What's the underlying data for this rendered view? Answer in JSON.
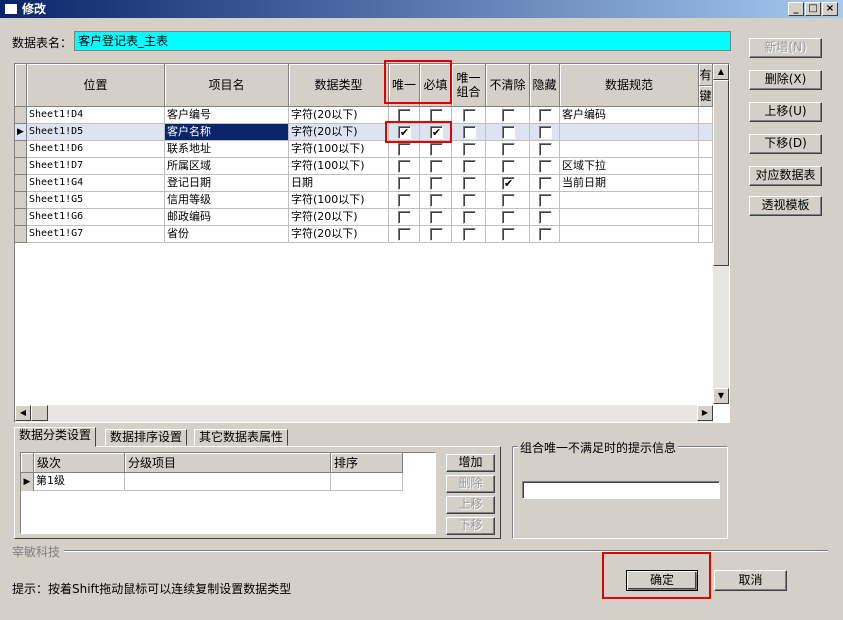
{
  "window": {
    "title": "修改",
    "controls": [
      "_",
      "□",
      "×"
    ]
  },
  "table_name": {
    "label": "数据表名：",
    "value": "客户登记表_主表"
  },
  "side_buttons": {
    "add": "新增(N)",
    "delete": "删除(X)",
    "move_up": "上移(U)",
    "move_down": "下移(D)",
    "map_table": "对应数据表",
    "pivot_template": "透视模板"
  },
  "grid": {
    "columns": [
      "位置",
      "项目名",
      "数据类型",
      "唯一",
      "必填",
      "唯一\n组合",
      "不清除",
      "隐藏",
      "数据规范",
      "有",
      "键"
    ],
    "rows": [
      {
        "pos": "Sheet1!D4",
        "name": "客户编号",
        "type": "字符(20以下)",
        "unique": false,
        "required": false,
        "combo": false,
        "noclear": false,
        "hidden": false,
        "spec": "客户编码",
        "current": false
      },
      {
        "pos": "Sheet1!D5",
        "name": "客户名称",
        "type": "字符(20以下)",
        "unique": true,
        "required": true,
        "combo": false,
        "noclear": false,
        "hidden": false,
        "spec": "",
        "current": true
      },
      {
        "pos": "Sheet1!D6",
        "name": "联系地址",
        "type": "字符(100以下)",
        "unique": false,
        "required": false,
        "combo": false,
        "noclear": false,
        "hidden": false,
        "spec": "",
        "current": false
      },
      {
        "pos": "Sheet1!D7",
        "name": "所属区域",
        "type": "字符(100以下)",
        "unique": false,
        "required": false,
        "combo": false,
        "noclear": false,
        "hidden": false,
        "spec": "区域下拉",
        "current": false
      },
      {
        "pos": "Sheet1!G4",
        "name": "登记日期",
        "type": "日期",
        "unique": false,
        "required": false,
        "combo": false,
        "noclear": true,
        "hidden": false,
        "spec": "当前日期",
        "current": false
      },
      {
        "pos": "Sheet1!G5",
        "name": "信用等级",
        "type": "字符(100以下)",
        "unique": false,
        "required": false,
        "combo": false,
        "noclear": false,
        "hidden": false,
        "spec": "",
        "current": false
      },
      {
        "pos": "Sheet1!G6",
        "name": "邮政编码",
        "type": "字符(20以下)",
        "unique": false,
        "required": false,
        "combo": false,
        "noclear": false,
        "hidden": false,
        "spec": "",
        "current": false
      },
      {
        "pos": "Sheet1!G7",
        "name": "省份",
        "type": "字符(20以下)",
        "unique": false,
        "required": false,
        "combo": false,
        "noclear": false,
        "hidden": false,
        "spec": "",
        "current": false
      }
    ]
  },
  "tabs": [
    "数据分类设置",
    "数据排序设置",
    "其它数据表属性"
  ],
  "classify": {
    "columns": [
      "级次",
      "分级项目",
      "排序"
    ],
    "rows": [
      {
        "level": "第1级",
        "item": "",
        "sort": ""
      }
    ],
    "buttons": {
      "add": "增加",
      "delete": "删除",
      "up": "上移",
      "down": "下移"
    }
  },
  "combo_group": {
    "title": "组合唯一不满足时的提示信息",
    "value": ""
  },
  "company": "宰敏科技",
  "hint": "提示：按着Shift拖动鼠标可以连续复制设置数据类型",
  "footer": {
    "ok": "确定",
    "cancel": "取消"
  },
  "colors": {
    "title_start": "#0a246a",
    "title_end": "#a6caf0",
    "table_name_bg": "#00ffff",
    "highlight": "#e00000"
  }
}
